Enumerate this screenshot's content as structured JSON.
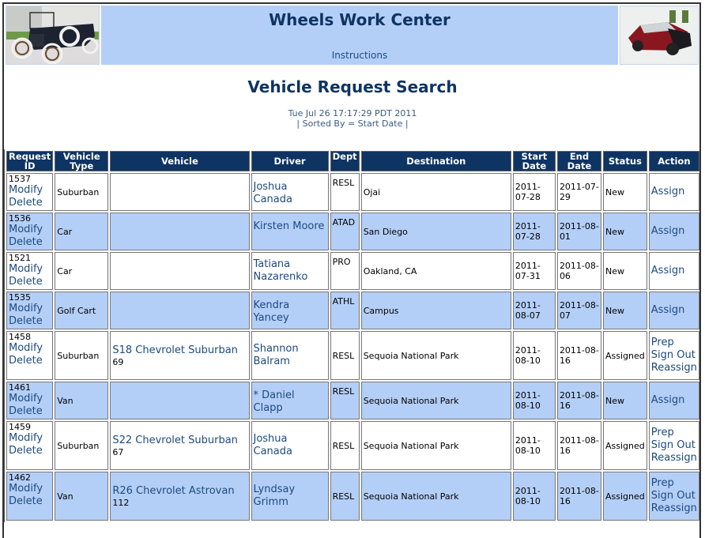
{
  "header": {
    "title": "Wheels Work Center",
    "instructions_link": "Instructions",
    "left_image": "vintage-car-image",
    "right_image": "sports-car-image"
  },
  "page": {
    "title": "Vehicle Request Search",
    "timestamp": "Tue Jul 26 17:17:29 PDT 2011",
    "sort_info": "| Sorted By = Start Date |"
  },
  "table": {
    "columns": [
      "Request ID",
      "Vehicle Type",
      "Vehicle",
      "Driver",
      "Dept",
      "Destination",
      "Start Date",
      "End Date",
      "Status",
      "Action"
    ],
    "modify_label": "Modify",
    "delete_label": "Delete",
    "rows": [
      {
        "id": "1537",
        "type": "Suburban",
        "vehicle": "",
        "vehicle_num": "",
        "driver": "Joshua Canada",
        "dept": "RESL",
        "destination": "Ojai",
        "start": "2011-07-28",
        "end": "2011-07-29",
        "status": "New",
        "actions": [
          "Assign"
        ]
      },
      {
        "id": "1536",
        "type": "Car",
        "vehicle": "",
        "vehicle_num": "",
        "driver": "Kirsten Moore",
        "dept": "ATAD",
        "destination": "San Diego",
        "start": "2011-07-28",
        "end": "2011-08-01",
        "status": "New",
        "actions": [
          "Assign"
        ]
      },
      {
        "id": "1521",
        "type": "Car",
        "vehicle": "",
        "vehicle_num": "",
        "driver": "Tatiana Nazarenko",
        "dept": "PRO",
        "destination": "Oakland, CA",
        "start": "2011-07-31",
        "end": "2011-08-06",
        "status": "New",
        "actions": [
          "Assign"
        ]
      },
      {
        "id": "1535",
        "type": "Golf Cart",
        "vehicle": "",
        "vehicle_num": "",
        "driver": "Kendra Yancey",
        "dept": "ATHL",
        "destination": "Campus",
        "start": "2011-08-07",
        "end": "2011-08-07",
        "status": "New",
        "actions": [
          "Assign"
        ]
      },
      {
        "id": "1458",
        "type": "Suburban",
        "vehicle": "S18 Chevrolet Suburban",
        "vehicle_num": "69",
        "driver": "Shannon Balram",
        "dept": "RESL",
        "destination": "Sequoia National Park",
        "start": "2011-08-10",
        "end": "2011-08-16",
        "status": "Assigned",
        "actions": [
          "Prep",
          "Sign Out",
          "Reassign"
        ]
      },
      {
        "id": "1461",
        "type": "Van",
        "vehicle": "",
        "vehicle_num": "",
        "driver": "* Daniel Clapp",
        "dept": "RESL",
        "destination": "Sequoia National Park",
        "start": "2011-08-10",
        "end": "2011-08-16",
        "status": "New",
        "actions": [
          "Assign"
        ]
      },
      {
        "id": "1459",
        "type": "Suburban",
        "vehicle": "S22 Chevrolet Suburban",
        "vehicle_num": "67",
        "driver": "Joshua Canada",
        "dept": "RESL",
        "destination": "Sequoia National Park",
        "start": "2011-08-10",
        "end": "2011-08-16",
        "status": "Assigned",
        "actions": [
          "Prep",
          "Sign Out",
          "Reassign"
        ]
      },
      {
        "id": "1462",
        "type": "Van",
        "vehicle": "R26 Chevrolet Astrovan",
        "vehicle_num": "112",
        "driver": "Lyndsay Grimm",
        "dept": "RESL",
        "destination": "Sequoia National Park",
        "start": "2011-08-10",
        "end": "2011-08-16",
        "status": "Assigned",
        "actions": [
          "Prep",
          "Sign Out",
          "Reassign"
        ]
      }
    ]
  }
}
